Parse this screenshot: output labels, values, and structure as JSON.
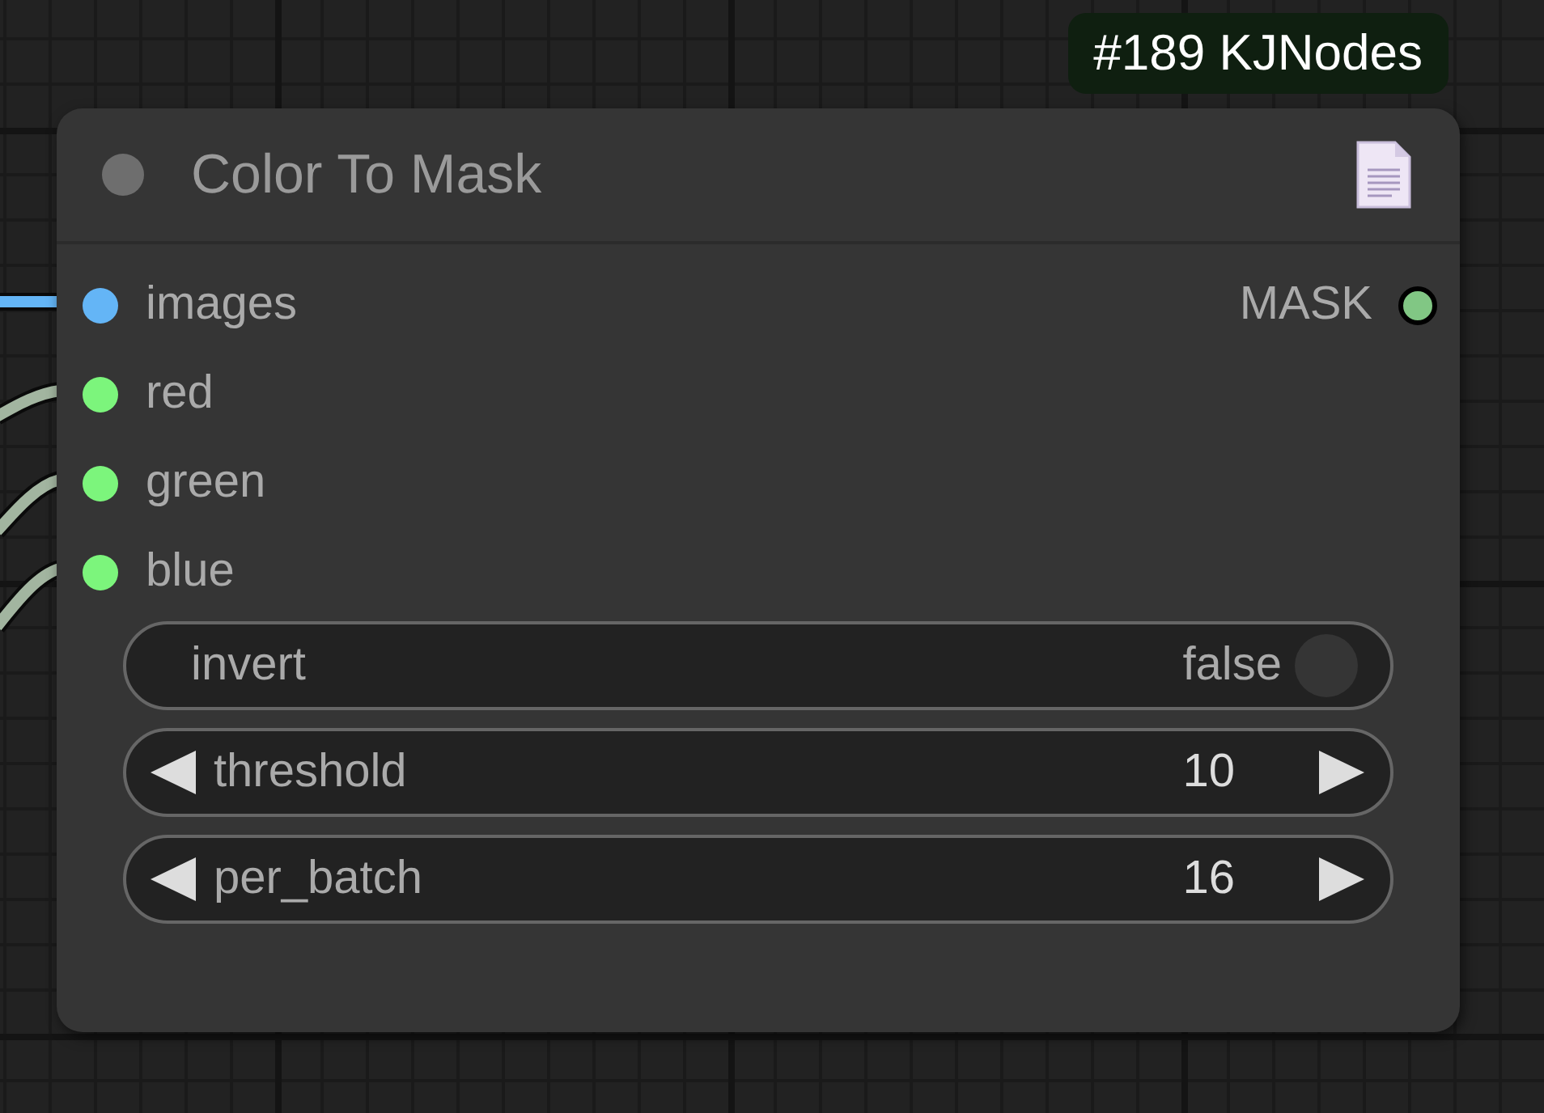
{
  "badge": {
    "text": "#189 KJNodes"
  },
  "node": {
    "title": "Color To Mask",
    "inputs": [
      {
        "name": "images",
        "color": "#64b5f6",
        "wire": {
          "color": "#64b5f6"
        }
      },
      {
        "name": "red",
        "color": "#7cf57c",
        "wire": {
          "color": "#a2b5a0"
        }
      },
      {
        "name": "green",
        "color": "#7cf57c",
        "wire": {
          "color": "#a2b5a0"
        }
      },
      {
        "name": "blue",
        "color": "#7cf57c",
        "wire": {
          "color": "#a2b5a0"
        }
      }
    ],
    "outputs": [
      {
        "name": "MASK",
        "color": "#81c784"
      }
    ],
    "widgets": [
      {
        "kind": "toggle",
        "label": "invert",
        "value": "false",
        "on": false
      },
      {
        "kind": "number",
        "label": "threshold",
        "value": "10"
      },
      {
        "kind": "number",
        "label": "per_batch",
        "value": "16"
      }
    ]
  }
}
